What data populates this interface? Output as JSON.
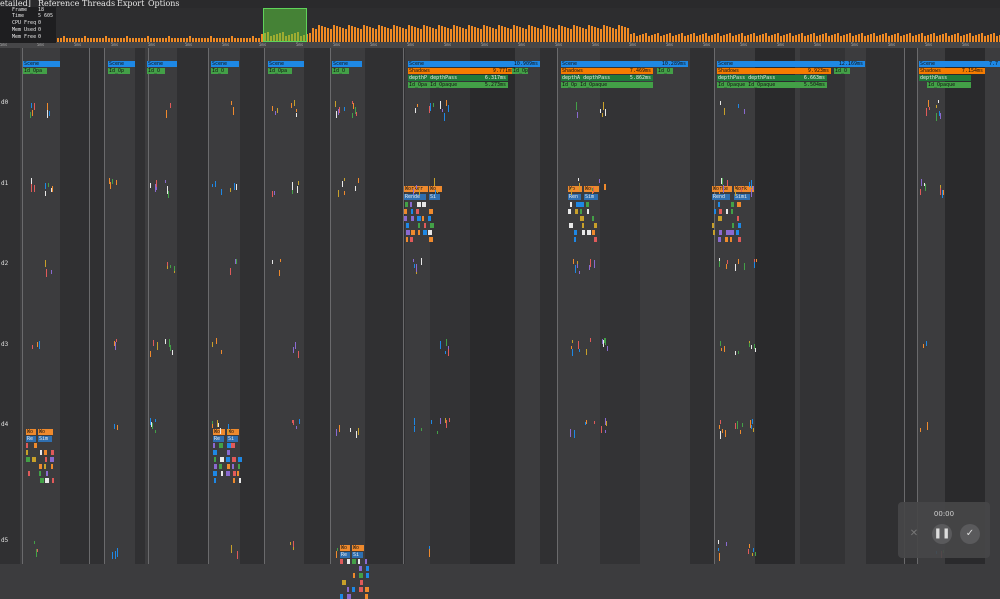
{
  "menu": {
    "items": [
      "etailed]",
      "Reference",
      "Threads",
      "Export",
      "Options"
    ]
  },
  "stats": {
    "rows": [
      {
        "key": "Frame",
        "value": "18"
      },
      {
        "key": "Time",
        "value": "5 605"
      },
      {
        "key": "CPU Freq",
        "value": "0"
      },
      {
        "key": "Mem Used",
        "value": "0"
      },
      {
        "key": "Mem Free",
        "value": "0"
      }
    ]
  },
  "ruler_label": "5ms",
  "thread_labels": [
    "d0",
    "d1",
    "d2",
    "d3",
    "d4",
    "d5"
  ],
  "frames": [
    {
      "scene": "Scene",
      "opaque": "Id_Opa"
    },
    {
      "scene": "Scene",
      "opaque": "Id_Op"
    },
    {
      "scene": "Scene",
      "opaque": "Id_O"
    },
    {
      "scene": "Scene",
      "opaque": "Id_O"
    },
    {
      "scene": "Scene",
      "opaque": "Id_Opa"
    },
    {
      "scene": "Scene",
      "opaque": "Id_O"
    }
  ],
  "big_frames": [
    {
      "scene": "Scene",
      "scene_time": "10.909ms",
      "shadows": "Shadows",
      "shadows_time": "9.771ms",
      "depth_a": "depthP",
      "depth_b": "depthPass",
      "depth_time": "6.317ms",
      "opaque_a": "Id_Opa",
      "opaque_b": "Id_Opaque",
      "opaque_time": "5.273ms",
      "opaque_side": "Id_Opa",
      "worker_a": "Worker",
      "worker_b": "Wo",
      "render_a": "Rende",
      "render_b": "Si"
    },
    {
      "scene": "Scene",
      "scene_time": "10.289ms",
      "shadows": "Shadows",
      "shadows_time": "7.469ms",
      "depth_a": "depthA",
      "depth_b": "depthPass",
      "depth_time": "5.862ms",
      "opaque_a": "Id_Op",
      "opaque_b": "Id_Opaque",
      "opaque_time": "",
      "opaque_side": "Id_O",
      "worker_a": "Wo",
      "worker_b": "Wor",
      "render_a": "Ren",
      "render_b": "Sim"
    },
    {
      "scene": "Scene",
      "scene_time": "12.169ms",
      "shadows": "Shadows",
      "shadows_time": "9.923ms",
      "depth_a": "depthPass",
      "depth_b": "depthPass",
      "depth_time": "6.663ms",
      "opaque_a": "Id_Opaque",
      "opaque_b": "Id_Opaque",
      "opaque_time": "5.504ms",
      "opaque_side": "Id_O",
      "worker_a": "Worke",
      "worker_b": "Work",
      "render_a": "Rend",
      "render_b": "Simi"
    },
    {
      "scene": "Scene",
      "scene_time": "7.7",
      "shadows": "Shadows",
      "shadows_time": "7.154ms",
      "depth_a": "depthPass",
      "depth_b": "",
      "depth_time": "",
      "opaque_a": "Id_Opaque",
      "opaque_b": "",
      "opaque_time": "",
      "opaque_side": "",
      "worker_a": "",
      "worker_b": "",
      "render_a": "",
      "render_b": ""
    }
  ],
  "small_workers": [
    {
      "a": "Wo",
      "b": "Wo",
      "c": "Re",
      "d": "Sim"
    },
    {
      "a": "Wo",
      "b": "Wo",
      "c": "Re",
      "d": "Si"
    },
    {
      "a": "Wo",
      "b": "Wo",
      "c": "Re",
      "d": "Si"
    }
  ],
  "recorder": {
    "time": "00:00",
    "close_icon": "close-icon",
    "pause_icon": "pause-icon",
    "check_icon": "check-icon"
  },
  "colors": {
    "scene": "#1e88e5",
    "shadows": "#f57c00",
    "depth": "#1f7a3a",
    "opaque": "#43a047",
    "worker": "#ef8a2d",
    "render": "#2f6fb0",
    "histogram": "#f08a24",
    "selection": "#5fd35a"
  }
}
